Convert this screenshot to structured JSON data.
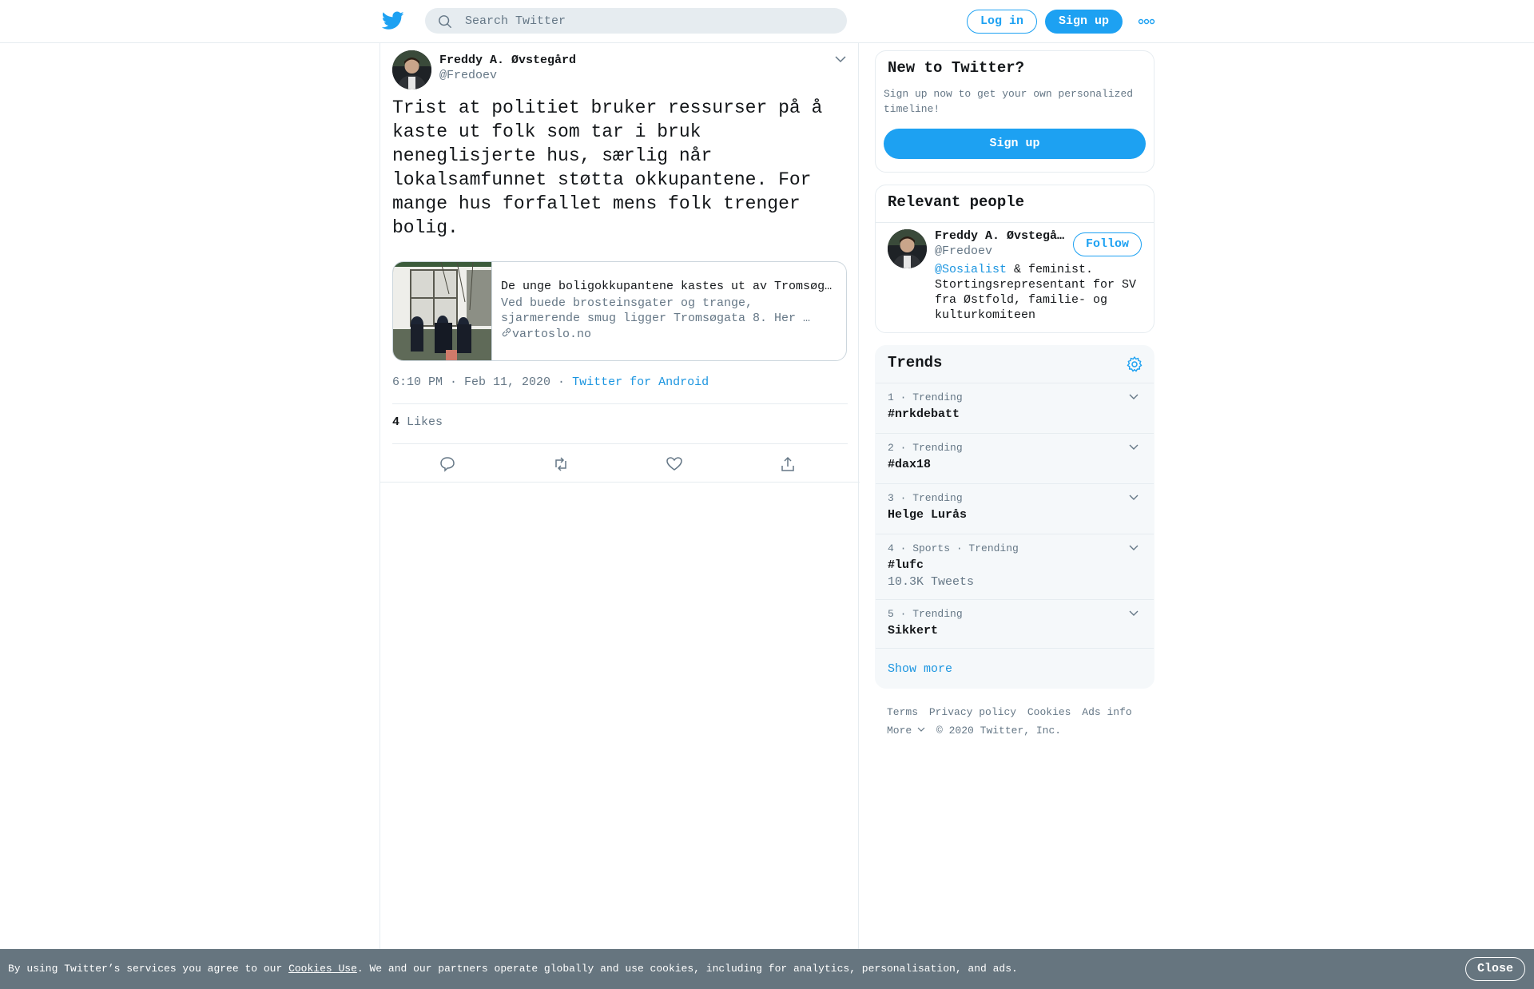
{
  "header": {
    "search_placeholder": "Search Twitter",
    "login_label": "Log in",
    "signup_label": "Sign up"
  },
  "tweet": {
    "author_name": "Freddy A. Øvstegård",
    "author_handle": "@Fredoev",
    "text": "Trist at politiet bruker ressurser på å kaste ut folk som tar i bruk neneglisjerte hus, særlig når lokalsamfunnet støtta okkupantene. For mange hus forfallet mens folk trenger bolig.",
    "card": {
      "title": "De unge boligokkupantene kastes ut av Tromsøgata",
      "description": "Ved buede brosteinsgater og trange, sjarmerende smug ligger Tromsøgata 8. Her …",
      "domain": "vartoslo.no"
    },
    "time": "6:10 PM · Feb 11, 2020 ·",
    "source": "Twitter for Android",
    "likes_count": "4",
    "likes_label": "Likes"
  },
  "sidebar": {
    "new_to_twitter": {
      "title": "New to Twitter?",
      "subtitle": "Sign up now to get your own personalized timeline!",
      "button": "Sign up"
    },
    "relevant_people": {
      "title": "Relevant people",
      "name": "Freddy A. Øvstegård",
      "handle": "@Fredoev",
      "follow_label": "Follow",
      "bio_mention": "@Sosialist",
      "bio_rest": " & feminist. Stortingsrepresentant for SV fra Østfold, familie- og kulturkomiteen"
    },
    "trends": {
      "title": "Trends",
      "items": [
        {
          "meta": "1 · Trending",
          "name": "#nrkdebatt",
          "count": ""
        },
        {
          "meta": "2 · Trending",
          "name": "#dax18",
          "count": ""
        },
        {
          "meta": "3 · Trending",
          "name": "Helge Lurås",
          "count": ""
        },
        {
          "meta": "4 · Sports · Trending",
          "name": "#lufc",
          "count": "10.3K Tweets"
        },
        {
          "meta": "5 · Trending",
          "name": "Sikkert",
          "count": ""
        }
      ],
      "show_more": "Show more"
    },
    "footer": {
      "terms": "Terms",
      "privacy": "Privacy policy",
      "cookies": "Cookies",
      "ads": "Ads info",
      "more": "More",
      "copyright": "© 2020 Twitter, Inc."
    }
  },
  "cookie_bar": {
    "text_before": "By using Twitter’s services you agree to our ",
    "link": "Cookies Use",
    "text_after": ". We and our partners operate globally and use cookies, including for analytics, personalisation, and ads.",
    "close": "Close"
  },
  "colors": {
    "brand": "#1da1f2",
    "link": "#1b95e0",
    "muted": "#657786",
    "border": "#e6ecf0",
    "cookie_bg": "#66757f"
  }
}
